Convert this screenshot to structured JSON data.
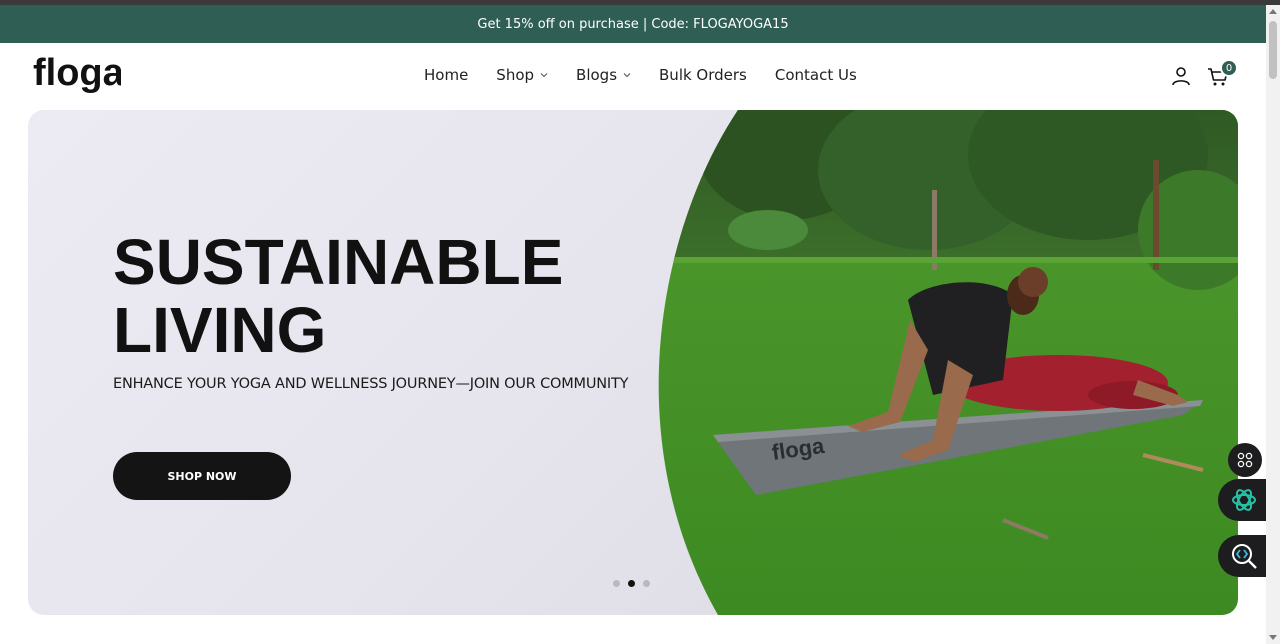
{
  "announcement": {
    "text": "Get 15% off on purchase | Code: FLOGAYOGA15"
  },
  "brand": {
    "logo_text": "floga",
    "accent": "#2f5e55"
  },
  "nav": {
    "items": [
      {
        "label": "Home",
        "has_dropdown": false
      },
      {
        "label": "Shop",
        "has_dropdown": true
      },
      {
        "label": "Blogs",
        "has_dropdown": true
      },
      {
        "label": "Bulk Orders",
        "has_dropdown": false
      },
      {
        "label": "Contact Us",
        "has_dropdown": false
      }
    ]
  },
  "header_icons": {
    "account": "user-icon",
    "cart": "cart-icon",
    "cart_count": "0"
  },
  "hero": {
    "title_line1": "SUSTAINABLE",
    "title_line2": "LIVING",
    "subtitle": "ENHANCE YOUR YOGA AND WELLNESS JOURNEY—JOIN OUR COMMUNITY",
    "cta_label": "SHOP NOW",
    "mat_print": "floga",
    "slides": 3,
    "active_slide": 2
  },
  "floating_widgets": [
    "apps-grid-icon",
    "ai-assistant-icon",
    "code-search-icon"
  ]
}
